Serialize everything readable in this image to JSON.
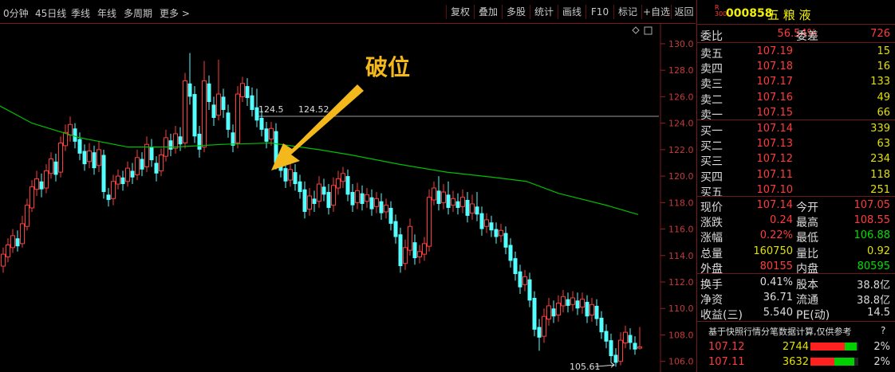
{
  "toolbar": {
    "periods": [
      "0分钟",
      "45日线",
      "季线",
      "年线",
      "多周期",
      "更多 >"
    ],
    "buttons": [
      "复权",
      "叠加",
      "多股",
      "统计",
      "画线",
      "F10",
      "标记",
      "+自选",
      "返回"
    ]
  },
  "stock": {
    "badge_top": "R",
    "badge_bottom": "300",
    "code": "000858",
    "name": "五 粮 液"
  },
  "order_book": {
    "ratio_label": "委比",
    "ratio_value": "56.54%",
    "diff_label": "委差",
    "diff_value": "726",
    "asks": [
      {
        "label": "卖五",
        "price": "107.19",
        "vol": "15"
      },
      {
        "label": "卖四",
        "price": "107.18",
        "vol": "16"
      },
      {
        "label": "卖三",
        "price": "107.17",
        "vol": "133"
      },
      {
        "label": "卖二",
        "price": "107.16",
        "vol": "49"
      },
      {
        "label": "卖一",
        "price": "107.15",
        "vol": "66"
      }
    ],
    "bids": [
      {
        "label": "买一",
        "price": "107.14",
        "vol": "339"
      },
      {
        "label": "买二",
        "price": "107.13",
        "vol": "63"
      },
      {
        "label": "买三",
        "price": "107.12",
        "vol": "234"
      },
      {
        "label": "买四",
        "price": "107.11",
        "vol": "118"
      },
      {
        "label": "买五",
        "price": "107.10",
        "vol": "251"
      }
    ]
  },
  "quote": [
    {
      "l1": "现价",
      "v1": "107.14",
      "l2": "今开",
      "v2": "107.05",
      "c1": "red",
      "c2": "red"
    },
    {
      "l1": "涨跌",
      "v1": "0.24",
      "l2": "最高",
      "v2": "108.55",
      "c1": "red",
      "c2": "red"
    },
    {
      "l1": "涨幅",
      "v1": "0.22%",
      "l2": "最低",
      "v2": "106.88",
      "c1": "red",
      "c2": "grn"
    },
    {
      "l1": "总量",
      "v1": "160750",
      "l2": "量比",
      "v2": "0.92",
      "c1": "yel",
      "c2": "yel"
    },
    {
      "l1": "外盘",
      "v1": "80155",
      "l2": "内盘",
      "v2": "80595",
      "c1": "red",
      "c2": "grn"
    }
  ],
  "fundamentals": [
    {
      "l1": "换手",
      "v1": "0.41%",
      "l2": "股本",
      "v2": "38.8亿"
    },
    {
      "l1": "净资",
      "v1": "36.71",
      "l2": "流通",
      "v2": "38.8亿"
    },
    {
      "l1": "收益(三)",
      "v1": "5.540",
      "l2": "PE(动)",
      "v2": "14.5"
    }
  ],
  "notice": {
    "text": "基于快照行情分笔数据计算,仅供参考",
    "help": "?"
  },
  "ticks": [
    {
      "price": "107.12",
      "vol": "2744",
      "pct": "2%",
      "red": 0.72,
      "green": 0.25
    },
    {
      "price": "107.11",
      "vol": "3632",
      "pct": "2%",
      "red": 0.5,
      "green": 0.42
    }
  ],
  "chart_data": {
    "type": "candlestick",
    "yticks": [
      "130.0",
      "128.0",
      "126.0",
      "124.0",
      "122.0",
      "120.0",
      "118.0",
      "116.0",
      "114.0",
      "112.0",
      "110.0",
      "108.0",
      "106.0"
    ],
    "ylim": [
      105.2,
      131.5
    ],
    "annotation": "破位",
    "marker_high": "124.52",
    "marker_high_partial": "124.5",
    "marker_low": "105.61",
    "ref_price": 124.52,
    "low_price": 105.61,
    "ma_color": "#00c000",
    "up_color": "#ff3c3c",
    "down_color": "#54ffff",
    "ma": [
      [
        0,
        125.3
      ],
      [
        40,
        124.0
      ],
      [
        100,
        122.9
      ],
      [
        160,
        122.2
      ],
      [
        220,
        122.2
      ],
      [
        280,
        122.4
      ],
      [
        340,
        122.5
      ],
      [
        400,
        122.0
      ],
      [
        440,
        121.6
      ],
      [
        500,
        120.9
      ],
      [
        560,
        120.3
      ],
      [
        620,
        119.9
      ],
      [
        660,
        119.6
      ],
      [
        700,
        118.7
      ],
      [
        760,
        117.8
      ],
      [
        800,
        117.1
      ]
    ],
    "candles": [
      {
        "x": 4,
        "o": 113.2,
        "c": 114.1,
        "h": 114.6,
        "l": 112.7
      },
      {
        "x": 10,
        "o": 113.9,
        "c": 114.8,
        "h": 115.3,
        "l": 113.5
      },
      {
        "x": 16,
        "o": 114.6,
        "c": 115.5,
        "h": 116.0,
        "l": 114.2
      },
      {
        "x": 22,
        "o": 115.3,
        "c": 114.7,
        "h": 115.9,
        "l": 114.3
      },
      {
        "x": 28,
        "o": 114.9,
        "c": 116.4,
        "h": 117.0,
        "l": 114.6
      },
      {
        "x": 34,
        "o": 116.2,
        "c": 117.8,
        "h": 118.3,
        "l": 115.9
      },
      {
        "x": 40,
        "o": 117.6,
        "c": 119.2,
        "h": 119.7,
        "l": 117.3
      },
      {
        "x": 46,
        "o": 119.0,
        "c": 119.8,
        "h": 120.4,
        "l": 118.5
      },
      {
        "x": 52,
        "o": 119.6,
        "c": 119.0,
        "h": 120.2,
        "l": 118.4
      },
      {
        "x": 58,
        "o": 119.1,
        "c": 120.4,
        "h": 120.9,
        "l": 118.7
      },
      {
        "x": 64,
        "o": 120.2,
        "c": 121.3,
        "h": 121.8,
        "l": 119.8
      },
      {
        "x": 70,
        "o": 121.1,
        "c": 120.1,
        "h": 121.7,
        "l": 119.6
      },
      {
        "x": 76,
        "o": 120.3,
        "c": 122.5,
        "h": 123.0,
        "l": 119.9
      },
      {
        "x": 82,
        "o": 122.3,
        "c": 123.3,
        "h": 123.9,
        "l": 121.9
      },
      {
        "x": 88,
        "o": 123.1,
        "c": 123.9,
        "h": 124.5,
        "l": 122.6
      },
      {
        "x": 94,
        "o": 123.6,
        "c": 122.6,
        "h": 124.0,
        "l": 122.1
      },
      {
        "x": 100,
        "o": 122.8,
        "c": 121.7,
        "h": 123.3,
        "l": 121.2
      },
      {
        "x": 106,
        "o": 121.9,
        "c": 120.9,
        "h": 122.4,
        "l": 120.4
      },
      {
        "x": 112,
        "o": 121.1,
        "c": 121.9,
        "h": 122.5,
        "l": 120.6
      },
      {
        "x": 118,
        "o": 121.8,
        "c": 120.6,
        "h": 122.3,
        "l": 120.1
      },
      {
        "x": 124,
        "o": 120.8,
        "c": 122.0,
        "h": 122.6,
        "l": 120.3
      },
      {
        "x": 130,
        "o": 121.6,
        "c": 118.8,
        "h": 122.0,
        "l": 118.3
      },
      {
        "x": 136,
        "o": 118.6,
        "c": 118.2,
        "h": 119.1,
        "l": 117.7
      },
      {
        "x": 142,
        "o": 118.3,
        "c": 119.6,
        "h": 120.1,
        "l": 117.8
      },
      {
        "x": 148,
        "o": 119.4,
        "c": 120.0,
        "h": 120.5,
        "l": 119.0
      },
      {
        "x": 154,
        "o": 119.9,
        "c": 119.4,
        "h": 120.4,
        "l": 118.9
      },
      {
        "x": 160,
        "o": 119.6,
        "c": 120.6,
        "h": 121.1,
        "l": 119.2
      },
      {
        "x": 166,
        "o": 120.4,
        "c": 119.9,
        "h": 121.0,
        "l": 119.4
      },
      {
        "x": 172,
        "o": 120.1,
        "c": 121.4,
        "h": 122.0,
        "l": 119.7
      },
      {
        "x": 178,
        "o": 121.3,
        "c": 120.5,
        "h": 121.8,
        "l": 120.0
      },
      {
        "x": 184,
        "o": 120.7,
        "c": 122.4,
        "h": 123.0,
        "l": 120.3
      },
      {
        "x": 190,
        "o": 122.2,
        "c": 121.2,
        "h": 122.8,
        "l": 120.7
      },
      {
        "x": 196,
        "o": 121.0,
        "c": 120.2,
        "h": 121.5,
        "l": 119.6
      },
      {
        "x": 202,
        "o": 120.4,
        "c": 121.6,
        "h": 122.1,
        "l": 120.0
      },
      {
        "x": 208,
        "o": 121.5,
        "c": 122.9,
        "h": 123.5,
        "l": 121.1
      },
      {
        "x": 214,
        "o": 122.7,
        "c": 122.0,
        "h": 123.2,
        "l": 121.5
      },
      {
        "x": 220,
        "o": 122.1,
        "c": 123.2,
        "h": 123.8,
        "l": 121.7
      },
      {
        "x": 226,
        "o": 123.0,
        "c": 122.4,
        "h": 123.7,
        "l": 121.9
      },
      {
        "x": 232,
        "o": 122.5,
        "c": 127.2,
        "h": 127.8,
        "l": 122.1
      },
      {
        "x": 238,
        "o": 127.0,
        "c": 126.0,
        "h": 129.3,
        "l": 125.4
      },
      {
        "x": 244,
        "o": 126.2,
        "c": 123.0,
        "h": 126.8,
        "l": 122.5
      },
      {
        "x": 250,
        "o": 123.2,
        "c": 122.0,
        "h": 123.8,
        "l": 121.4
      },
      {
        "x": 256,
        "o": 122.2,
        "c": 127.2,
        "h": 128.7,
        "l": 121.8
      },
      {
        "x": 262,
        "o": 127.0,
        "c": 125.6,
        "h": 127.6,
        "l": 125.0
      },
      {
        "x": 268,
        "o": 125.4,
        "c": 124.4,
        "h": 126.0,
        "l": 123.8
      },
      {
        "x": 274,
        "o": 124.6,
        "c": 126.2,
        "h": 128.8,
        "l": 124.2
      },
      {
        "x": 280,
        "o": 126.0,
        "c": 125.0,
        "h": 126.6,
        "l": 124.4
      },
      {
        "x": 286,
        "o": 124.8,
        "c": 123.5,
        "h": 125.4,
        "l": 122.9
      },
      {
        "x": 292,
        "o": 123.3,
        "c": 122.3,
        "h": 123.9,
        "l": 121.8
      },
      {
        "x": 298,
        "o": 122.5,
        "c": 126.2,
        "h": 126.8,
        "l": 122.1
      },
      {
        "x": 304,
        "o": 126.0,
        "c": 127.0,
        "h": 127.5,
        "l": 125.6
      },
      {
        "x": 310,
        "o": 126.8,
        "c": 125.9,
        "h": 127.4,
        "l": 125.3
      },
      {
        "x": 316,
        "o": 126.1,
        "c": 125.0,
        "h": 126.7,
        "l": 124.5
      },
      {
        "x": 322,
        "o": 125.2,
        "c": 124.2,
        "h": 126.6,
        "l": 123.7
      },
      {
        "x": 328,
        "o": 124.4,
        "c": 123.5,
        "h": 125.0,
        "l": 123.0
      },
      {
        "x": 334,
        "o": 123.6,
        "c": 122.6,
        "h": 124.1,
        "l": 122.1
      },
      {
        "x": 340,
        "o": 122.8,
        "c": 123.6,
        "h": 124.1,
        "l": 122.3
      },
      {
        "x": 346,
        "o": 123.4,
        "c": 121.0,
        "h": 124.0,
        "l": 120.5
      },
      {
        "x": 352,
        "o": 121.2,
        "c": 120.4,
        "h": 121.8,
        "l": 119.9
      },
      {
        "x": 358,
        "o": 120.6,
        "c": 119.6,
        "h": 121.2,
        "l": 119.1
      },
      {
        "x": 364,
        "o": 119.7,
        "c": 120.5,
        "h": 121.0,
        "l": 119.2
      },
      {
        "x": 370,
        "o": 120.3,
        "c": 119.4,
        "h": 120.9,
        "l": 118.9
      },
      {
        "x": 376,
        "o": 119.6,
        "c": 118.8,
        "h": 120.1,
        "l": 118.3
      },
      {
        "x": 382,
        "o": 119.0,
        "c": 117.3,
        "h": 119.6,
        "l": 116.8
      },
      {
        "x": 388,
        "o": 117.5,
        "c": 118.5,
        "h": 119.1,
        "l": 117.0
      },
      {
        "x": 394,
        "o": 118.3,
        "c": 117.9,
        "h": 118.9,
        "l": 117.3
      },
      {
        "x": 400,
        "o": 118.1,
        "c": 119.4,
        "h": 120.0,
        "l": 117.6
      },
      {
        "x": 406,
        "o": 119.2,
        "c": 118.6,
        "h": 119.8,
        "l": 118.1
      },
      {
        "x": 412,
        "o": 118.8,
        "c": 117.6,
        "h": 119.4,
        "l": 117.1
      },
      {
        "x": 418,
        "o": 117.8,
        "c": 119.3,
        "h": 119.9,
        "l": 117.3
      },
      {
        "x": 424,
        "o": 119.1,
        "c": 119.8,
        "h": 120.4,
        "l": 118.6
      },
      {
        "x": 430,
        "o": 119.6,
        "c": 120.2,
        "h": 120.7,
        "l": 119.1
      },
      {
        "x": 436,
        "o": 120.0,
        "c": 118.6,
        "h": 120.5,
        "l": 118.1
      },
      {
        "x": 442,
        "o": 118.8,
        "c": 117.8,
        "h": 119.4,
        "l": 117.3
      },
      {
        "x": 448,
        "o": 118.0,
        "c": 118.9,
        "h": 119.5,
        "l": 117.5
      },
      {
        "x": 454,
        "o": 118.7,
        "c": 117.9,
        "h": 119.3,
        "l": 117.4
      },
      {
        "x": 460,
        "o": 118.1,
        "c": 118.6,
        "h": 119.1,
        "l": 117.6
      },
      {
        "x": 466,
        "o": 118.4,
        "c": 117.5,
        "h": 119.0,
        "l": 117.0
      },
      {
        "x": 472,
        "o": 117.7,
        "c": 118.3,
        "h": 118.8,
        "l": 117.2
      },
      {
        "x": 478,
        "o": 118.1,
        "c": 117.2,
        "h": 118.7,
        "l": 116.7
      },
      {
        "x": 484,
        "o": 117.3,
        "c": 117.8,
        "h": 118.3,
        "l": 116.8
      },
      {
        "x": 490,
        "o": 117.6,
        "c": 116.4,
        "h": 118.1,
        "l": 115.9
      },
      {
        "x": 496,
        "o": 116.6,
        "c": 115.4,
        "h": 117.1,
        "l": 114.9
      },
      {
        "x": 502,
        "o": 115.6,
        "c": 113.2,
        "h": 116.1,
        "l": 112.7
      },
      {
        "x": 508,
        "o": 113.4,
        "c": 114.6,
        "h": 115.2,
        "l": 112.9
      },
      {
        "x": 514,
        "o": 114.4,
        "c": 116.2,
        "h": 116.8,
        "l": 114.0
      },
      {
        "x": 520,
        "o": 115.0,
        "c": 113.8,
        "h": 115.6,
        "l": 113.3
      },
      {
        "x": 526,
        "o": 113.9,
        "c": 114.3,
        "h": 114.8,
        "l": 113.4
      },
      {
        "x": 532,
        "o": 114.1,
        "c": 114.9,
        "h": 115.4,
        "l": 113.6
      },
      {
        "x": 538,
        "o": 114.7,
        "c": 118.4,
        "h": 119.0,
        "l": 114.3
      },
      {
        "x": 544,
        "o": 118.2,
        "c": 119.1,
        "h": 119.6,
        "l": 117.8
      },
      {
        "x": 550,
        "o": 118.9,
        "c": 117.9,
        "h": 120.0,
        "l": 117.4
      },
      {
        "x": 556,
        "o": 118.0,
        "c": 118.8,
        "h": 119.4,
        "l": 117.5
      },
      {
        "x": 562,
        "o": 118.6,
        "c": 117.6,
        "h": 119.6,
        "l": 117.1
      },
      {
        "x": 568,
        "o": 117.8,
        "c": 118.3,
        "h": 118.9,
        "l": 117.3
      },
      {
        "x": 574,
        "o": 118.1,
        "c": 117.6,
        "h": 118.7,
        "l": 117.1
      },
      {
        "x": 580,
        "o": 117.7,
        "c": 118.4,
        "h": 119.0,
        "l": 117.2
      },
      {
        "x": 586,
        "o": 118.2,
        "c": 117.0,
        "h": 118.8,
        "l": 116.5
      },
      {
        "x": 592,
        "o": 117.2,
        "c": 117.9,
        "h": 118.6,
        "l": 116.7
      },
      {
        "x": 598,
        "o": 117.7,
        "c": 117.1,
        "h": 118.8,
        "l": 116.6
      },
      {
        "x": 604,
        "o": 117.2,
        "c": 116.0,
        "h": 117.7,
        "l": 115.5
      },
      {
        "x": 610,
        "o": 116.2,
        "c": 116.7,
        "h": 117.2,
        "l": 115.7
      },
      {
        "x": 616,
        "o": 116.5,
        "c": 115.9,
        "h": 117.0,
        "l": 115.4
      },
      {
        "x": 622,
        "o": 116.0,
        "c": 115.4,
        "h": 116.5,
        "l": 114.9
      },
      {
        "x": 628,
        "o": 115.5,
        "c": 115.9,
        "h": 116.4,
        "l": 115.0
      },
      {
        "x": 634,
        "o": 115.7,
        "c": 114.6,
        "h": 116.2,
        "l": 114.1
      },
      {
        "x": 640,
        "o": 114.8,
        "c": 113.6,
        "h": 115.3,
        "l": 113.1
      },
      {
        "x": 646,
        "o": 113.8,
        "c": 112.6,
        "h": 114.3,
        "l": 112.1
      },
      {
        "x": 652,
        "o": 112.8,
        "c": 111.6,
        "h": 113.3,
        "l": 111.1
      },
      {
        "x": 658,
        "o": 111.8,
        "c": 112.4,
        "h": 112.9,
        "l": 111.3
      },
      {
        "x": 664,
        "o": 112.2,
        "c": 110.6,
        "h": 112.7,
        "l": 110.1
      },
      {
        "x": 670,
        "o": 110.8,
        "c": 108.4,
        "h": 111.3,
        "l": 107.9
      },
      {
        "x": 676,
        "o": 108.6,
        "c": 107.8,
        "h": 109.2,
        "l": 106.8
      },
      {
        "x": 682,
        "o": 107.9,
        "c": 109.4,
        "h": 110.0,
        "l": 107.4
      },
      {
        "x": 688,
        "o": 109.2,
        "c": 110.2,
        "h": 110.8,
        "l": 108.7
      },
      {
        "x": 694,
        "o": 110.0,
        "c": 109.4,
        "h": 110.6,
        "l": 108.9
      },
      {
        "x": 700,
        "o": 109.5,
        "c": 110.4,
        "h": 111.0,
        "l": 109.0
      },
      {
        "x": 706,
        "o": 110.2,
        "c": 110.9,
        "h": 111.4,
        "l": 109.7
      },
      {
        "x": 712,
        "o": 110.7,
        "c": 110.2,
        "h": 111.2,
        "l": 109.7
      },
      {
        "x": 718,
        "o": 110.3,
        "c": 110.8,
        "h": 111.3,
        "l": 109.8
      },
      {
        "x": 724,
        "o": 110.6,
        "c": 110.0,
        "h": 111.2,
        "l": 109.5
      },
      {
        "x": 730,
        "o": 110.1,
        "c": 110.7,
        "h": 111.2,
        "l": 109.6
      },
      {
        "x": 736,
        "o": 110.5,
        "c": 109.4,
        "h": 111.0,
        "l": 108.9
      },
      {
        "x": 742,
        "o": 109.5,
        "c": 110.3,
        "h": 110.8,
        "l": 109.0
      },
      {
        "x": 748,
        "o": 110.2,
        "c": 109.2,
        "h": 110.7,
        "l": 108.7
      },
      {
        "x": 754,
        "o": 109.3,
        "c": 108.2,
        "h": 109.8,
        "l": 107.7
      },
      {
        "x": 760,
        "o": 108.3,
        "c": 107.5,
        "h": 108.8,
        "l": 107.0
      },
      {
        "x": 766,
        "o": 107.6,
        "c": 106.4,
        "h": 108.1,
        "l": 105.9
      },
      {
        "x": 772,
        "o": 106.5,
        "c": 105.9,
        "h": 107.0,
        "l": 105.6
      },
      {
        "x": 778,
        "o": 106.0,
        "c": 107.6,
        "h": 108.2,
        "l": 105.7
      },
      {
        "x": 784,
        "o": 107.4,
        "c": 108.2,
        "h": 108.7,
        "l": 107.0
      },
      {
        "x": 790,
        "o": 108.0,
        "c": 107.4,
        "h": 108.5,
        "l": 106.9
      },
      {
        "x": 796,
        "o": 107.4,
        "c": 106.9,
        "h": 107.9,
        "l": 106.5
      },
      {
        "x": 802,
        "o": 107.0,
        "c": 107.1,
        "h": 108.6,
        "l": 106.9
      }
    ]
  }
}
